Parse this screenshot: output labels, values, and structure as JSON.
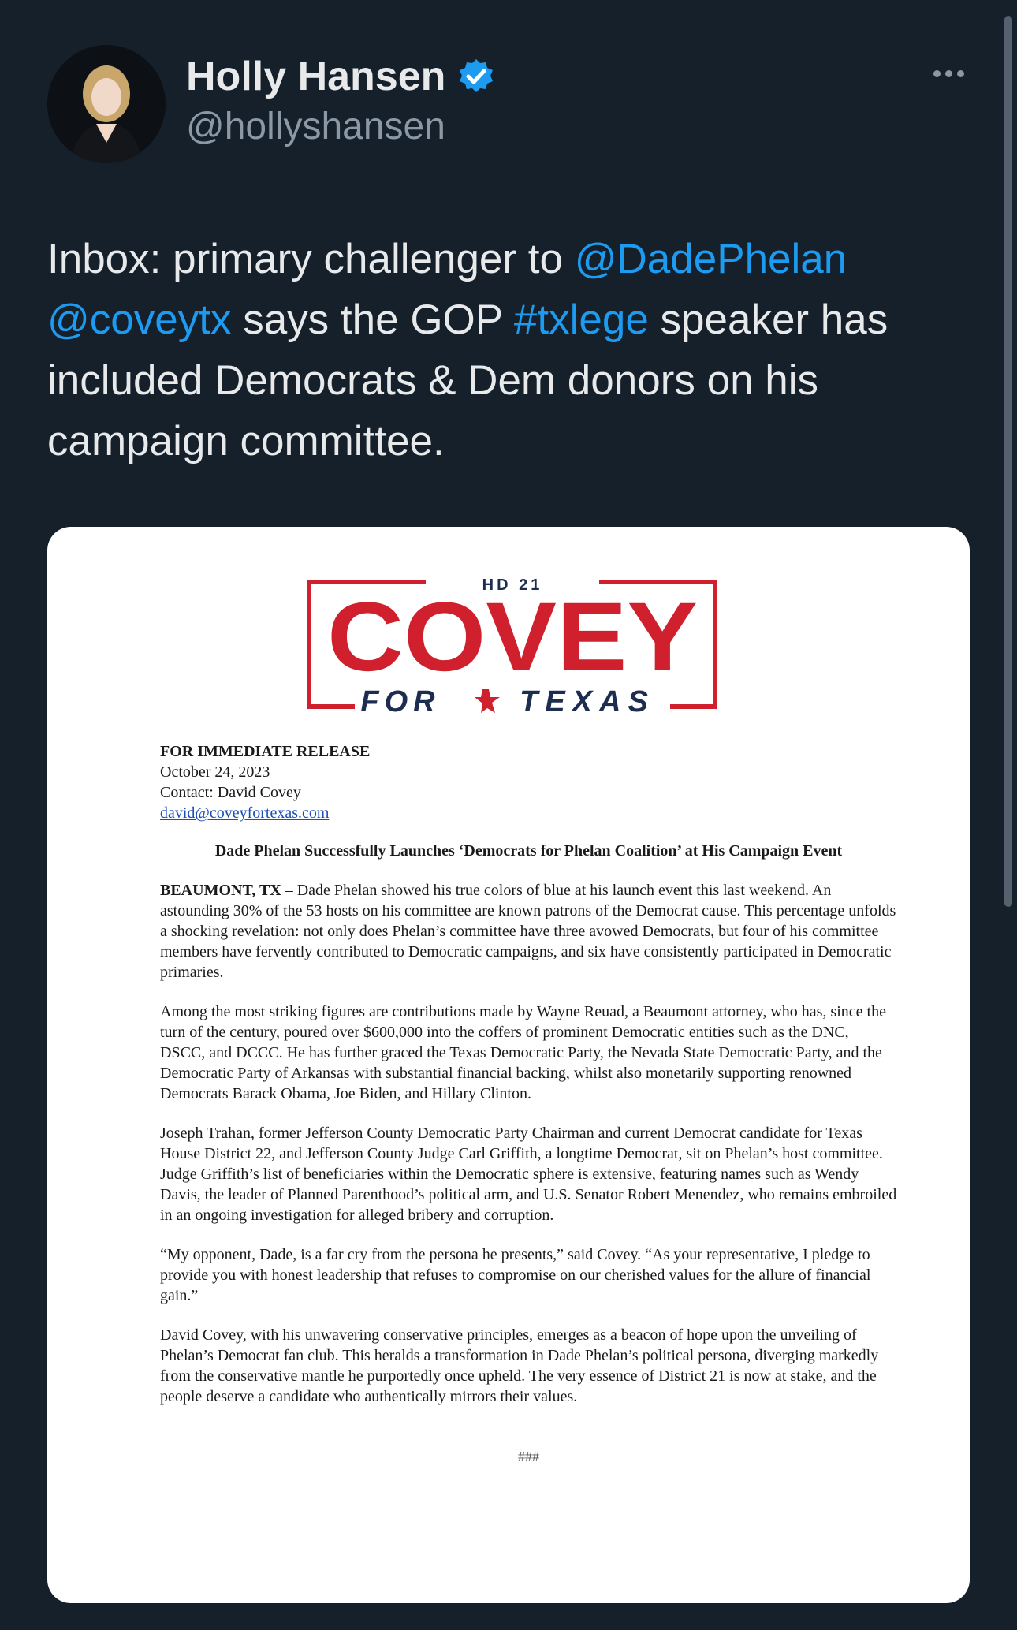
{
  "author": {
    "name": "Holly Hansen",
    "handle": "@hollyshansen",
    "verified": true,
    "avatar_icon": "avatar-photo",
    "more_icon": "more-icon"
  },
  "tweet": {
    "parts": [
      {
        "text": "Inbox: primary challenger to ",
        "kind": "text"
      },
      {
        "text": "@DadePhelan",
        "kind": "link"
      },
      {
        "text": " ",
        "kind": "text"
      },
      {
        "text": "@coveytx",
        "kind": "link"
      },
      {
        "text": " says the GOP ",
        "kind": "text"
      },
      {
        "text": "#txlege",
        "kind": "link"
      },
      {
        "text": " speaker has included Democrats & Dem donors on his campaign committee.",
        "kind": "text"
      }
    ]
  },
  "media": {
    "logo": {
      "district": "HD 21",
      "name": "COVEY",
      "left": "FOR",
      "right": "TEXAS"
    },
    "release_label": "FOR IMMEDIATE RELEASE",
    "date": "October 24, 2023",
    "contact": "Contact: David Covey",
    "email": "david@coveyfortexas.com",
    "headline": "Dade Phelan Successfully Launches ‘Democrats for Phelan Coalition’ at His Campaign Event",
    "dateline": "BEAUMONT, TX",
    "p1": " – Dade Phelan showed his true colors of blue at his launch event this last weekend. An astounding 30% of the 53 hosts on his committee are known patrons of the Democrat cause. This percentage unfolds a shocking revelation: not only does Phelan’s committee have three avowed Democrats, but four of his committee members have fervently contributed to Democratic campaigns, and six have consistently participated in Democratic primaries.",
    "p2": "Among the most striking figures are contributions made by Wayne Reuad, a Beaumont attorney, who has, since the turn of the century, poured over $600,000 into the coffers of prominent Democratic entities such as the DNC, DSCC, and DCCC. He has further graced the Texas Democratic Party, the Nevada State Democratic Party, and the Democratic Party of Arkansas with substantial financial backing, whilst also monetarily supporting renowned Democrats Barack Obama, Joe Biden, and Hillary Clinton.",
    "p3": "Joseph Trahan, former Jefferson County Democratic Party Chairman and current Democrat candidate for Texas House District 22, and Jefferson County Judge Carl Griffith, a longtime Democrat, sit on Phelan’s host committee. Judge Griffith’s list of beneficiaries within the Democratic sphere is extensive, featuring names such as Wendy Davis, the leader of Planned Parenthood’s political arm, and U.S. Senator Robert Menendez, who remains embroiled in an ongoing investigation for alleged bribery and corruption.",
    "p4": "“My opponent, Dade, is a far cry from the persona he presents,” said Covey. “As your representative, I pledge to provide you with honest leadership that refuses to compromise on our cherished values for the allure of financial gain.”",
    "p5": "David Covey, with his unwavering conservative principles, emerges as a beacon of hope upon the unveiling of Phelan’s Democrat fan club. This heralds a transformation in Dade Phelan’s political persona, diverging markedly from the conservative mantle he purportedly once upheld. The very essence of District 21 is now at stake, and the people deserve a candidate who authentically mirrors their values.",
    "end_mark": "###"
  },
  "colors": {
    "background": "#15202b",
    "link": "#1d9bf0",
    "logo_red": "#d0202e",
    "logo_navy": "#1d2d50"
  }
}
